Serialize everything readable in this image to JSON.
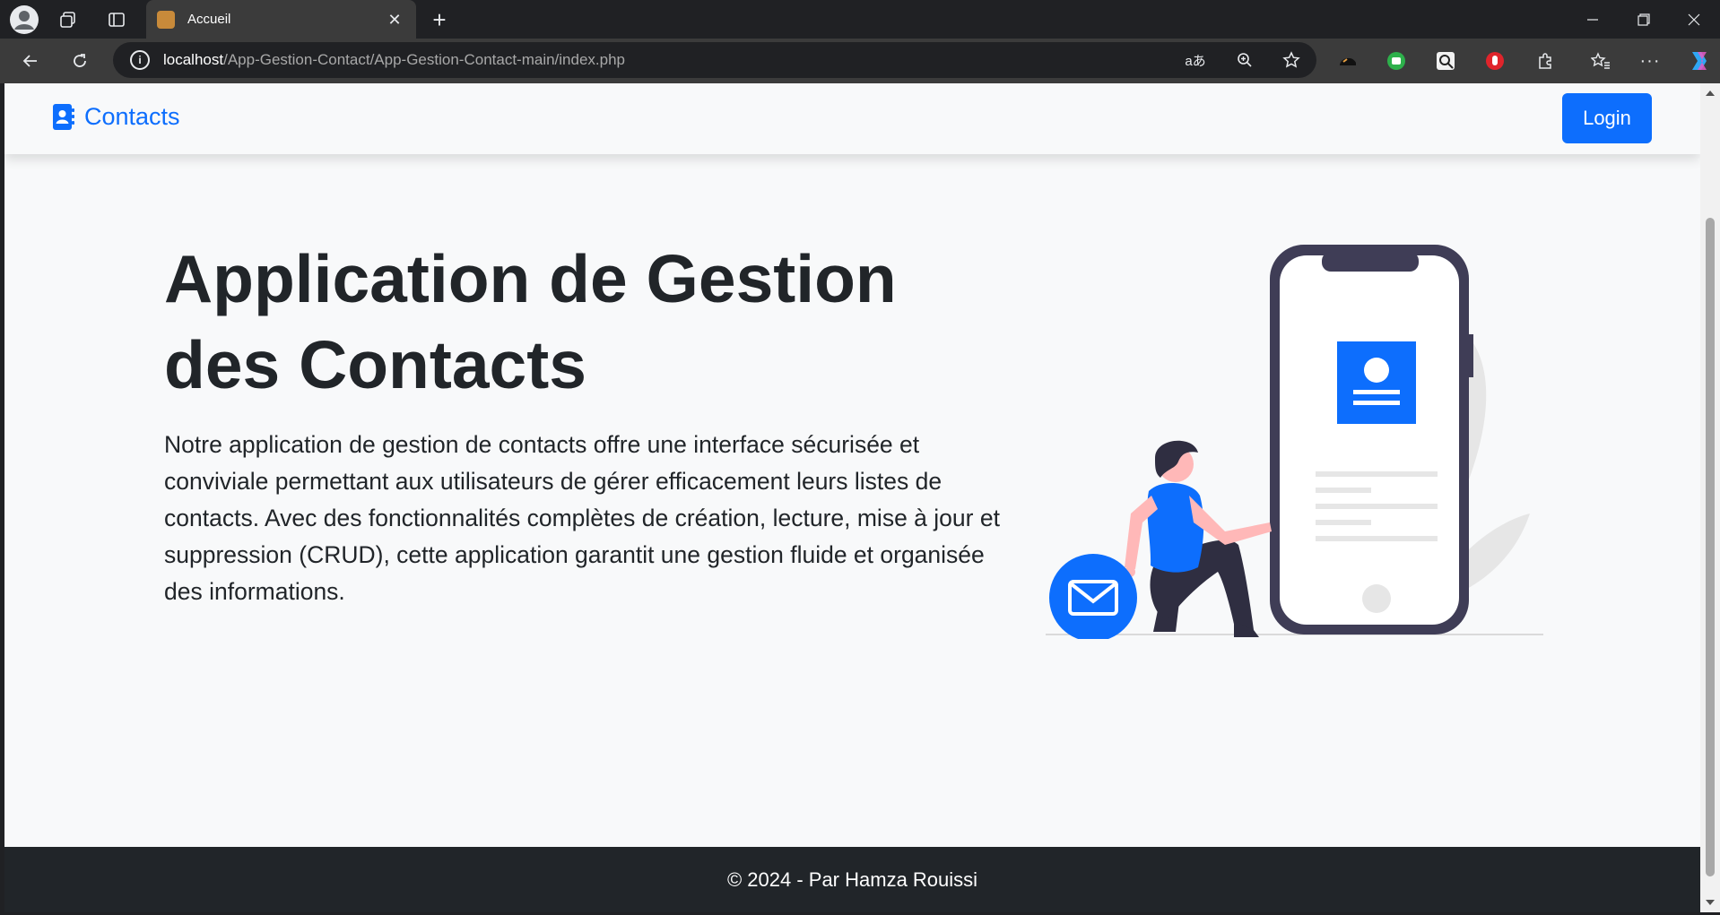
{
  "browser": {
    "tab_title": "Accueil",
    "url_host": "localhost",
    "url_path": "/App-Gestion-Contact/App-Gestion-Contact-main/index.php",
    "url_info": "i"
  },
  "navbar": {
    "brand": "Contacts",
    "login_label": "Login"
  },
  "hero": {
    "title": "Application de Gestion des Contacts",
    "description": "Notre application de gestion de contacts offre une interface sécurisée et conviviale permettant aux utilisateurs de gérer efficacement leurs listes de contacts. Avec des fonctionnalités complètes de création, lecture, mise à jour et suppression (CRUD), cette application garantit une gestion fluide et organisée des informations."
  },
  "footer": {
    "text": "© 2024 - Par Hamza Rouissi"
  },
  "colors": {
    "primary": "#0d6efd",
    "dark": "#212529",
    "page_bg": "#f8f9fa"
  }
}
